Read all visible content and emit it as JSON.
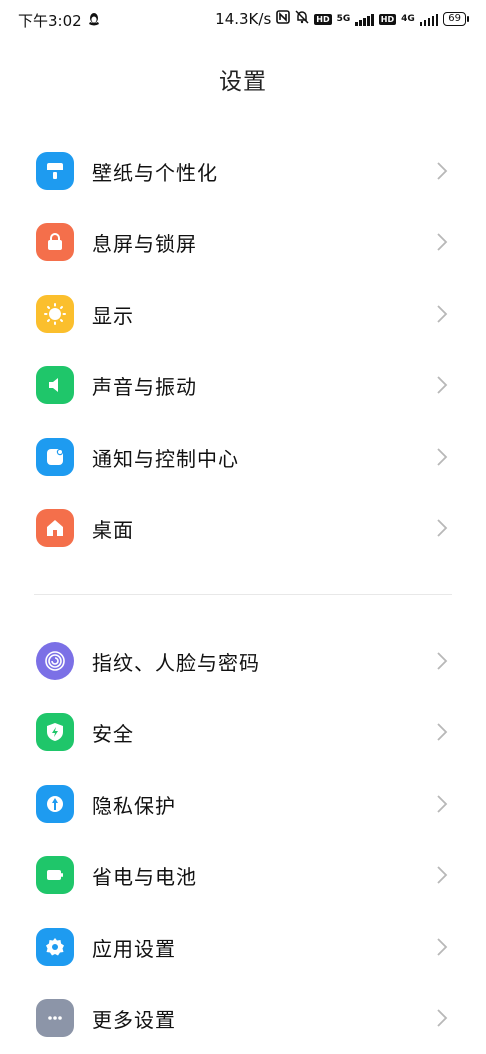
{
  "status": {
    "time": "下午3:02",
    "net_speed": "14.3K/s",
    "sim1_type": "5G",
    "hd1": "HD",
    "hd2": "HD",
    "sim2_type": "4G",
    "battery": "69"
  },
  "page": {
    "title": "设置"
  },
  "group1": [
    {
      "label": "壁纸与个性化",
      "icon": "wallpaper-icon",
      "color": "#1E9BF0"
    },
    {
      "label": "息屏与锁屏",
      "icon": "lock-icon",
      "color": "#F46F4B"
    },
    {
      "label": "显示",
      "icon": "sun-icon",
      "color": "#FBBF2D"
    },
    {
      "label": "声音与振动",
      "icon": "speaker-icon",
      "color": "#1FC66A"
    },
    {
      "label": "通知与控制中心",
      "icon": "notification-icon",
      "color": "#1E9BF0"
    },
    {
      "label": "桌面",
      "icon": "home-icon",
      "color": "#F46F4B"
    }
  ],
  "group2": [
    {
      "label": "指纹、人脸与密码",
      "icon": "fingerprint-icon",
      "color": "#7B70E6"
    },
    {
      "label": "安全",
      "icon": "shield-icon",
      "color": "#1FC66A"
    },
    {
      "label": "隐私保护",
      "icon": "privacy-icon",
      "color": "#1E9BF0"
    },
    {
      "label": "省电与电池",
      "icon": "battery-icon",
      "color": "#1FC66A"
    },
    {
      "label": "应用设置",
      "icon": "gear-icon",
      "color": "#1E9BF0"
    },
    {
      "label": "更多设置",
      "icon": "more-icon",
      "color": "#8C95A8"
    }
  ]
}
